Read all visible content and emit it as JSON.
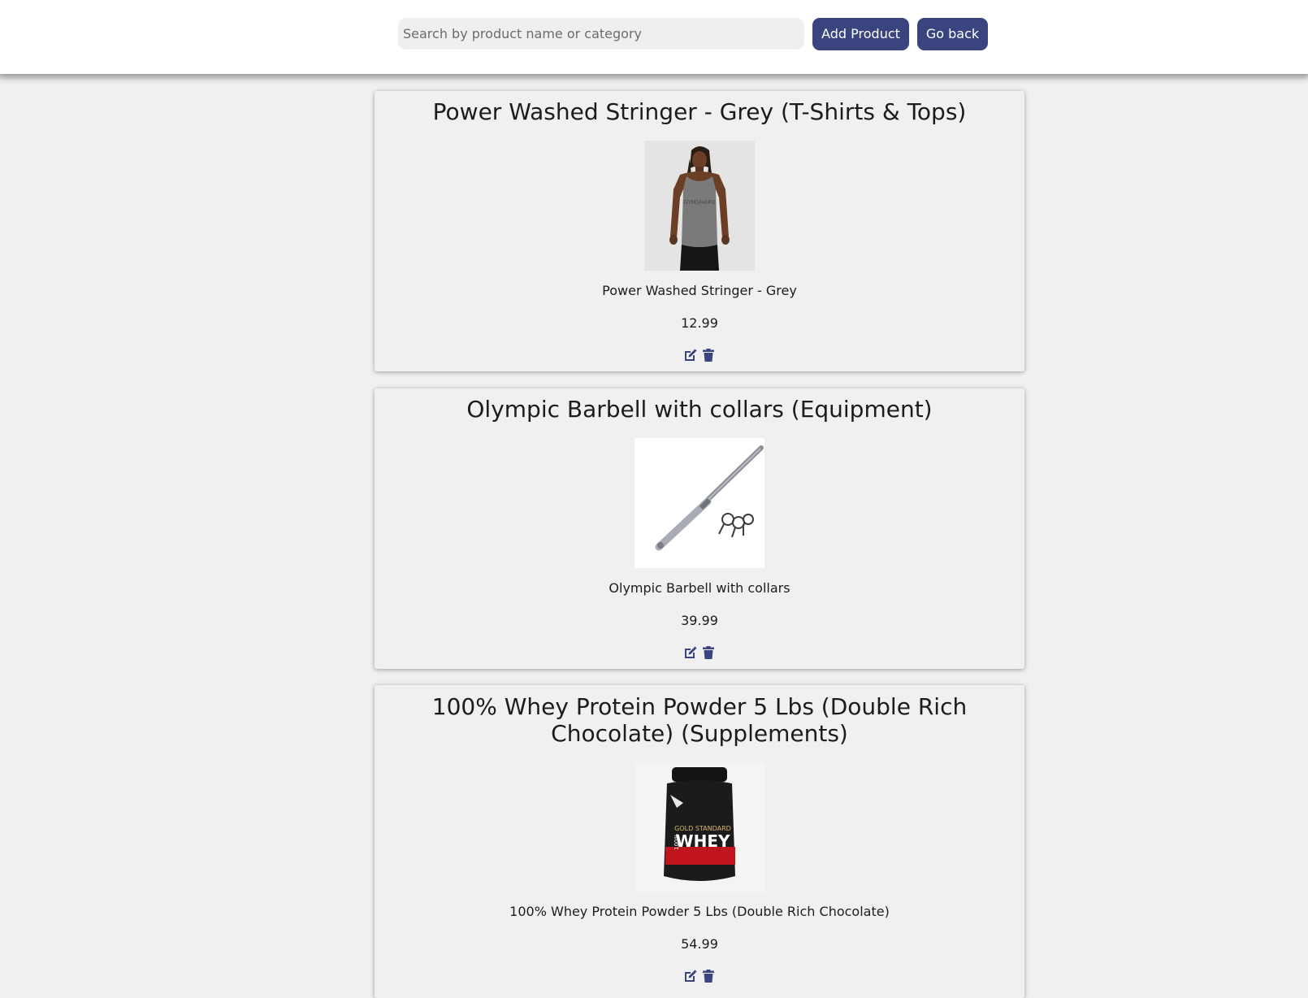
{
  "header": {
    "search": {
      "placeholder": "Search by product name or category",
      "value": ""
    },
    "add_label": "Add Product",
    "back_label": "Go back"
  },
  "products": [
    {
      "title": "Power Washed Stringer - Grey (T-Shirts & Tops)",
      "name": "Power Washed Stringer - Grey",
      "price": "12.99",
      "image_logo_text": "GYMSHARK"
    },
    {
      "title": "Olympic Barbell with collars (Equipment)",
      "name": "Olympic Barbell with collars",
      "price": "39.99"
    },
    {
      "title": "100% Whey Protein Powder 5 Lbs (Double Rich Chocolate) (Supplements)",
      "name": "100% Whey Protein Powder 5 Lbs (Double Rich Chocolate)",
      "price": "54.99",
      "image_label_top": "GOLD STANDARD",
      "image_label_main": "WHEY",
      "image_label_side": "100%"
    }
  ],
  "colors": {
    "accent": "#3a4580",
    "background": "#f0f0f0",
    "header": "#ffffff"
  },
  "icons": {
    "edit": "edit-icon",
    "delete": "trash-icon"
  }
}
